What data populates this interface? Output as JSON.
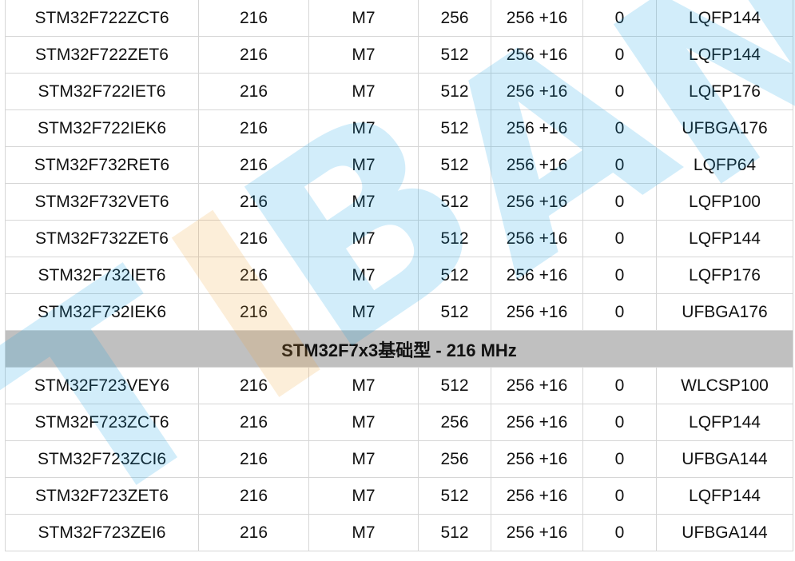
{
  "table": {
    "rows": [
      {
        "type": "data",
        "cells": [
          "STM32F722ZCT6",
          "216",
          "M7",
          "256",
          "256 +16",
          "0",
          "LQFP144"
        ]
      },
      {
        "type": "data",
        "cells": [
          "STM32F722ZET6",
          "216",
          "M7",
          "512",
          "256 +16",
          "0",
          "LQFP144"
        ]
      },
      {
        "type": "data",
        "cells": [
          "STM32F722IET6",
          "216",
          "M7",
          "512",
          "256 +16",
          "0",
          "LQFP176"
        ]
      },
      {
        "type": "data",
        "cells": [
          "STM32F722IEK6",
          "216",
          "M7",
          "512",
          "256 +16",
          "0",
          "UFBGA176"
        ]
      },
      {
        "type": "data",
        "cells": [
          "STM32F732RET6",
          "216",
          "M7",
          "512",
          "256 +16",
          "0",
          "LQFP64"
        ]
      },
      {
        "type": "data",
        "cells": [
          "STM32F732VET6",
          "216",
          "M7",
          "512",
          "256 +16",
          "0",
          "LQFP100"
        ]
      },
      {
        "type": "data",
        "cells": [
          "STM32F732ZET6",
          "216",
          "M7",
          "512",
          "256 +16",
          "0",
          "LQFP144"
        ]
      },
      {
        "type": "data",
        "cells": [
          "STM32F732IET6",
          "216",
          "M7",
          "512",
          "256 +16",
          "0",
          "LQFP176"
        ]
      },
      {
        "type": "data",
        "cells": [
          "STM32F732IEK6",
          "216",
          "M7",
          "512",
          "256 +16",
          "0",
          "UFBGA176"
        ]
      },
      {
        "type": "section",
        "title": "STM32F7x3基础型 - 216 MHz"
      },
      {
        "type": "data",
        "cells": [
          "STM32F723VEY6",
          "216",
          "M7",
          "512",
          "256 +16",
          "0",
          "WLCSP100"
        ]
      },
      {
        "type": "data",
        "cells": [
          "STM32F723ZCT6",
          "216",
          "M7",
          "256",
          "256 +16",
          "0",
          "LQFP144"
        ]
      },
      {
        "type": "data",
        "cells": [
          "STM32F723ZCI6",
          "216",
          "M7",
          "256",
          "256 +16",
          "0",
          "UFBGA144"
        ]
      },
      {
        "type": "data",
        "cells": [
          "STM32F723ZET6",
          "216",
          "M7",
          "512",
          "256 +16",
          "0",
          "LQFP144"
        ]
      },
      {
        "type": "data",
        "cells": [
          "STM32F723ZEI6",
          "216",
          "M7",
          "512",
          "256 +16",
          "0",
          "UFBGA144"
        ]
      }
    ]
  },
  "watermark": {
    "letters": [
      "T",
      "I",
      "B",
      "A",
      "N"
    ],
    "colors": {
      "blue": "#0fa0e6",
      "orange": "#f2a334"
    }
  },
  "colors": {
    "section_background": "#c0c0c0",
    "grid_line": "#d6d6d6",
    "text": "#111111"
  }
}
